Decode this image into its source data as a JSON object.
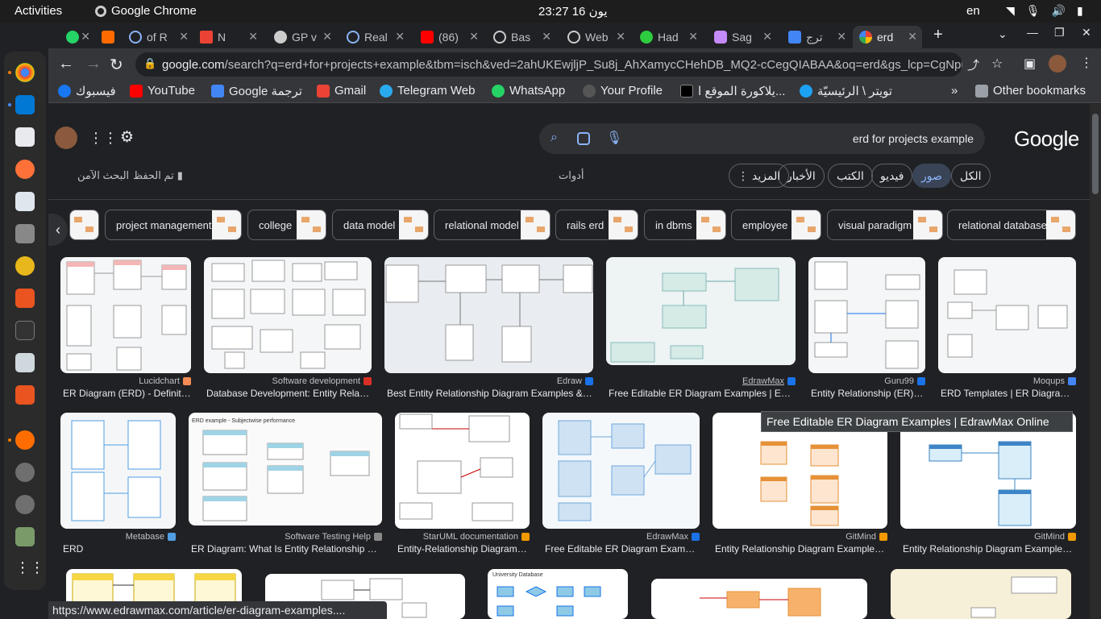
{
  "system": {
    "activities": "Activities",
    "app_name": "Google Chrome",
    "clock": "23:27  يون 16",
    "language": "en"
  },
  "tabs": [
    {
      "label": "",
      "color": "#25d366"
    },
    {
      "label": "",
      "color": "#ff6a00"
    },
    {
      "label": "of R",
      "color": "#8ab4f8"
    },
    {
      "label": "N",
      "color": "#ea4335"
    },
    {
      "label": "GP v",
      "color": "#cccccc"
    },
    {
      "label": "Real",
      "color": "#8ab4f8"
    },
    {
      "label": "(86)",
      "color": "#ff0000"
    },
    {
      "label": "Bas",
      "color": "#cccccc"
    },
    {
      "label": "Web",
      "color": "#cccccc"
    },
    {
      "label": "Had",
      "color": "#2ecc40"
    },
    {
      "label": "Sag",
      "color": "#c58af9"
    },
    {
      "label": "ترج",
      "color": "#4285f4"
    },
    {
      "label": "erd",
      "color": "#4285f4"
    }
  ],
  "url": {
    "domain": "google.com",
    "path": "/search?q=erd+for+projects+example&tbm=isch&ved=2ahUKEwjljP_Su8j_AhXamycCHehDB_MQ2-cCegQIABAA&oq=erd&gs_lcp=CgNpbWcQA..."
  },
  "bookmarks": [
    {
      "label": "فيسبوك",
      "color": "#1877f2"
    },
    {
      "label": "YouTube",
      "color": "#ff0000"
    },
    {
      "label": "Google ترجمة",
      "color": "#4285f4"
    },
    {
      "label": "Gmail",
      "color": "#ea4335"
    },
    {
      "label": "Telegram Web",
      "color": "#2aabee"
    },
    {
      "label": "WhatsApp",
      "color": "#25d366"
    },
    {
      "label": "Your Profile",
      "color": "#555555"
    },
    {
      "label": "يلاكورة الموقع ا...",
      "color": "#000000"
    },
    {
      "label": "تويتر \\ الرئيسيّة",
      "color": "#1da1f2"
    }
  ],
  "bookmarks_more": "»",
  "other_bookmarks": "Other bookmarks",
  "search": {
    "query": "erd for projects example",
    "logo": "Google"
  },
  "filters": {
    "all": "الكل",
    "images": "صور",
    "videos": "فيديو",
    "books": "الكتب",
    "news": "الأخبار",
    "more": "المزيد",
    "tools": "أدوات",
    "safesearch": "البحث الآمن",
    "saved": "تم الحفظ"
  },
  "related": [
    "project management",
    "college",
    "data model",
    "relational model",
    "rails erd",
    "in dbms",
    "employee",
    "visual paradigm",
    "relational database"
  ],
  "results": [
    {
      "source": "Lucidchart",
      "title": "ER Diagram (ERD) - Definitio...",
      "color": "#f28b54"
    },
    {
      "source": "Software development",
      "title": "Database Development: Entity Relatio...",
      "color": "#d93025"
    },
    {
      "source": "Edraw",
      "title": "Best Entity Relationship Diagram Examples & Te...",
      "color": "#1a73e8"
    },
    {
      "source": "EdrawMax",
      "title": "Free Editable ER Diagram Examples | Edra...",
      "color": "#1a73e8"
    },
    {
      "source": "Guru99",
      "title": "Entity Relationship (ER) D...",
      "color": "#1a73e8"
    },
    {
      "source": "Moqups",
      "title": "ERD Templates | ER Diagram E...",
      "color": "#4285f4"
    },
    {
      "source": "Metabase",
      "title": "ERD",
      "color": "#509ee3"
    },
    {
      "source": "Software Testing Help",
      "title": "ER Diagram: What Is Entity Relationship Dia...",
      "color": "#888888"
    },
    {
      "source": "StarUML documentation",
      "title": "Entity-Relationship Diagram - ...",
      "color": "#f29900"
    },
    {
      "source": "EdrawMax",
      "title": "Free Editable ER Diagram Example...",
      "color": "#1a73e8"
    },
    {
      "source": "GitMind",
      "title": "Entity Relationship Diagram Examples ...",
      "color": "#f29900"
    },
    {
      "source": "GitMind",
      "title": "Entity Relationship Diagram Examples ...",
      "color": "#f29900"
    }
  ],
  "tooltip": "Free Editable ER Diagram Examples | EdrawMax Online",
  "status_url": "https://www.edrawmax.com/article/er-diagram-examples...."
}
